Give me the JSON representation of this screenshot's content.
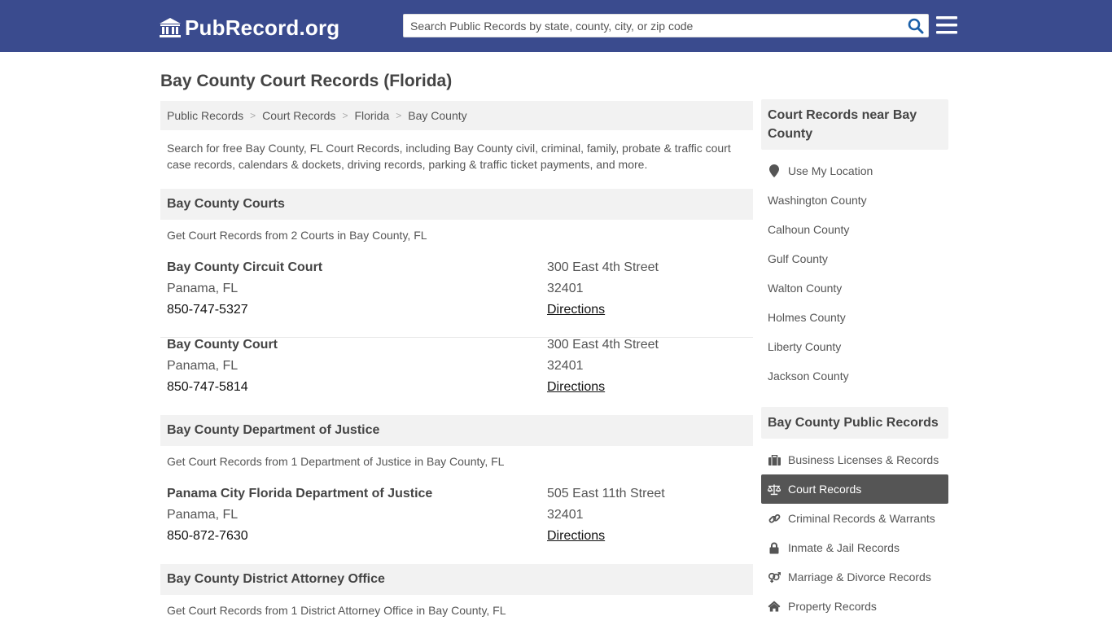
{
  "header": {
    "logo_text": "PubRecord.org",
    "search_placeholder": "Search Public Records by state, county, city, or zip code"
  },
  "page_title": "Bay County Court Records (Florida)",
  "breadcrumb": [
    "Public Records",
    "Court Records",
    "Florida",
    "Bay County"
  ],
  "intro": "Search for free Bay County, FL Court Records, including Bay County civil, criminal, family, probate & traffic court case records, calendars & dockets, driving records, parking & traffic ticket payments, and more.",
  "sections": [
    {
      "title": "Bay County Courts",
      "description": "Get Court Records from 2 Courts in Bay County, FL",
      "entries": [
        {
          "name": "Bay County Circuit Court",
          "city": "Panama, FL",
          "phone": "850-747-5327",
          "street": "300 East 4th Street",
          "zip": "32401",
          "directions": "Directions"
        },
        {
          "name": "Bay County Court",
          "city": "Panama, FL",
          "phone": "850-747-5814",
          "street": "300 East 4th Street",
          "zip": "32401",
          "directions": "Directions"
        }
      ]
    },
    {
      "title": "Bay County Department of Justice",
      "description": "Get Court Records from 1 Department of Justice in Bay County, FL",
      "entries": [
        {
          "name": "Panama City Florida Department of Justice",
          "city": "Panama, FL",
          "phone": "850-872-7630",
          "street": "505 East 11th Street",
          "zip": "32401",
          "directions": "Directions"
        }
      ]
    },
    {
      "title": "Bay County District Attorney Office",
      "description": "Get Court Records from 1 District Attorney Office in Bay County, FL",
      "entries": []
    }
  ],
  "sidebar": {
    "nearby_title": "Court Records near Bay County",
    "use_location": "Use My Location",
    "nearby": [
      "Washington County",
      "Calhoun County",
      "Gulf County",
      "Walton County",
      "Holmes County",
      "Liberty County",
      "Jackson County"
    ],
    "public_title": "Bay County Public Records",
    "public": [
      {
        "label": "Business Licenses & Records",
        "icon": "briefcase-icon"
      },
      {
        "label": "Court Records",
        "icon": "scale-icon",
        "active": true
      },
      {
        "label": "Criminal Records & Warrants",
        "icon": "link-icon"
      },
      {
        "label": "Inmate & Jail Records",
        "icon": "lock-icon"
      },
      {
        "label": "Marriage & Divorce Records",
        "icon": "marriage-icon"
      },
      {
        "label": "Property Records",
        "icon": "home-icon"
      }
    ]
  },
  "colors": {
    "header_bg": "#3a4b8e",
    "accent_icon": "#1a5fa8",
    "active_item_bg": "#555555"
  }
}
